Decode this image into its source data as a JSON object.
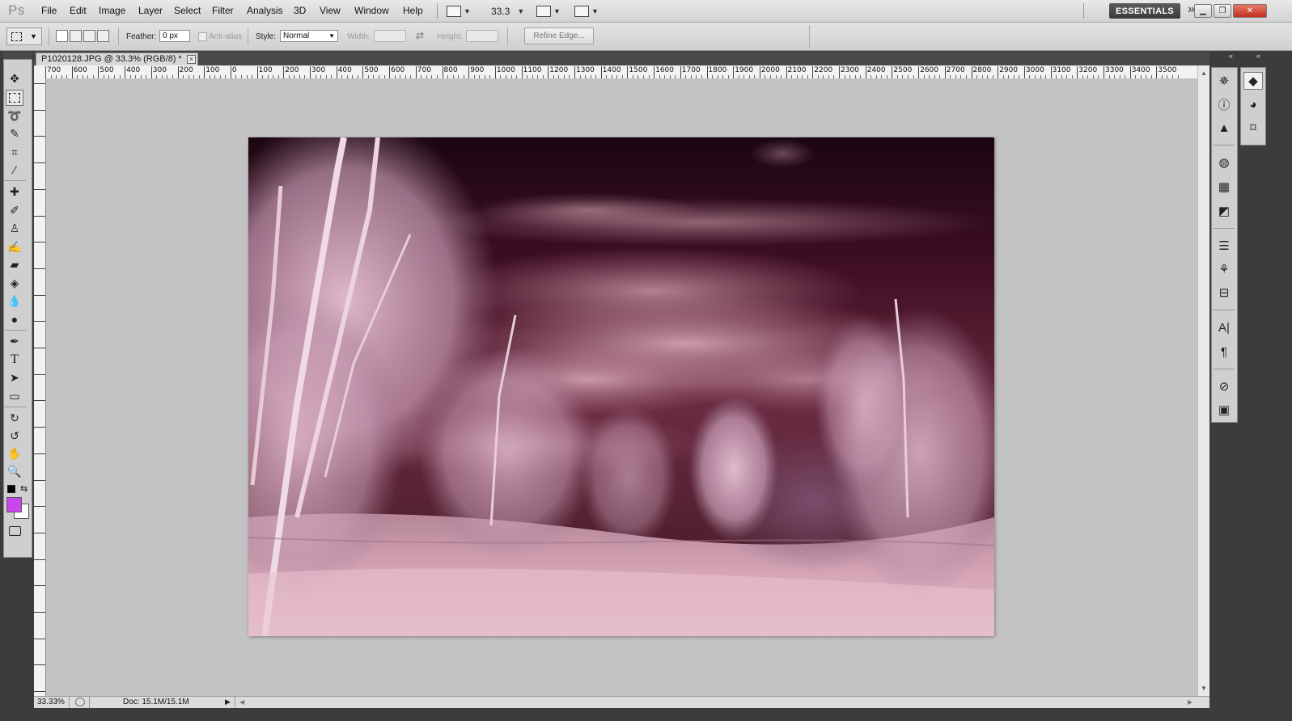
{
  "app": {
    "logo": "Ps"
  },
  "menu": [
    "File",
    "Edit",
    "Image",
    "Layer",
    "Select",
    "Filter",
    "Analysis",
    "3D",
    "View",
    "Window",
    "Help"
  ],
  "menubar_controls": {
    "zoom": "33.3",
    "workspace": "ESSENTIALS"
  },
  "options": {
    "feather_label": "Feather:",
    "feather_value": "0 px",
    "antialias_label": "Anti-alias",
    "style_label": "Style:",
    "style_value": "Normal",
    "width_label": "Width:",
    "height_label": "Height:",
    "refine_edge": "Refine Edge..."
  },
  "document": {
    "tab_title": "P1020128.JPG @ 33.3% (RGB/8) *"
  },
  "ruler_h_labels": [
    "700",
    "600",
    "500",
    "400",
    "300",
    "200",
    "100",
    "0",
    "100",
    "200",
    "300",
    "400",
    "500",
    "600",
    "700",
    "800",
    "900",
    "1000",
    "1100",
    "1200",
    "1300",
    "1400",
    "1500",
    "1600",
    "1700",
    "1800",
    "1900",
    "2000",
    "2100",
    "2200",
    "2300",
    "2400",
    "2500",
    "2600",
    "2700",
    "2800",
    "2900",
    "3000",
    "3100",
    "3200",
    "3300",
    "3400",
    "3500"
  ],
  "status": {
    "zoom": "33.33%",
    "doc": "Doc: 15.1M/15.1M"
  },
  "colors": {
    "foreground": "#cc44ee",
    "background": "#ffffff",
    "workspace_button": "#4a4a4a"
  },
  "tools": [
    "move-icon",
    "marquee-icon",
    "lasso-icon",
    "quick-selection-icon",
    "crop-icon",
    "eyedropper-icon",
    "spot-healing-icon",
    "brush-icon",
    "clone-stamp-icon",
    "history-brush-icon",
    "eraser-icon",
    "paint-bucket-icon",
    "blur-icon",
    "dodge-icon",
    "pen-icon",
    "type-icon",
    "path-selection-icon",
    "rectangle-icon",
    "3d-rotate-icon",
    "3d-orbit-icon",
    "hand-icon",
    "zoom-icon"
  ],
  "right_panel_icons": [
    "navigator-icon",
    "info-icon",
    "histogram-icon",
    "color-icon",
    "swatches-icon",
    "styles-icon",
    "adjustments-icon",
    "masks-icon",
    "layer-comps-icon",
    "character-icon",
    "paragraph-icon",
    "brushes-icon",
    "clone-source-icon",
    "layers-icon",
    "channels-icon",
    "paths-icon"
  ]
}
